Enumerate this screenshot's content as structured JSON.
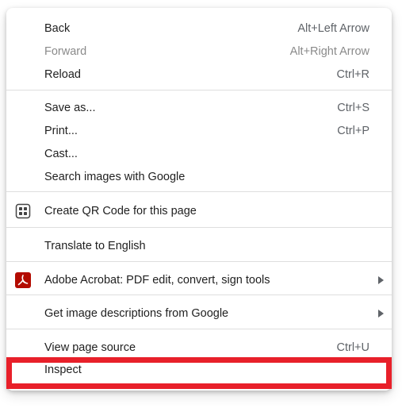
{
  "menu": {
    "items": [
      {
        "label": "Back",
        "shortcut": "Alt+Left Arrow"
      },
      {
        "label": "Forward",
        "shortcut": "Alt+Right Arrow"
      },
      {
        "label": "Reload",
        "shortcut": "Ctrl+R"
      },
      {
        "label": "Save as...",
        "shortcut": "Ctrl+S"
      },
      {
        "label": "Print...",
        "shortcut": "Ctrl+P"
      },
      {
        "label": "Cast..."
      },
      {
        "label": "Search images with Google"
      },
      {
        "label": "Create QR Code for this page",
        "icon": "qr-code-icon"
      },
      {
        "label": "Translate to English"
      },
      {
        "label": "Adobe Acrobat: PDF edit, convert, sign tools",
        "icon": "adobe-acrobat-icon"
      },
      {
        "label": "Get image descriptions from Google"
      },
      {
        "label": "View page source",
        "shortcut": "Ctrl+U"
      },
      {
        "label": "Inspect"
      }
    ]
  },
  "colors": {
    "highlight": "#e8202a",
    "acrobat": "#b30b00",
    "disabled_text": "#8a8a8a",
    "shortcut_text": "#5f6368",
    "separator": "#dedede"
  }
}
